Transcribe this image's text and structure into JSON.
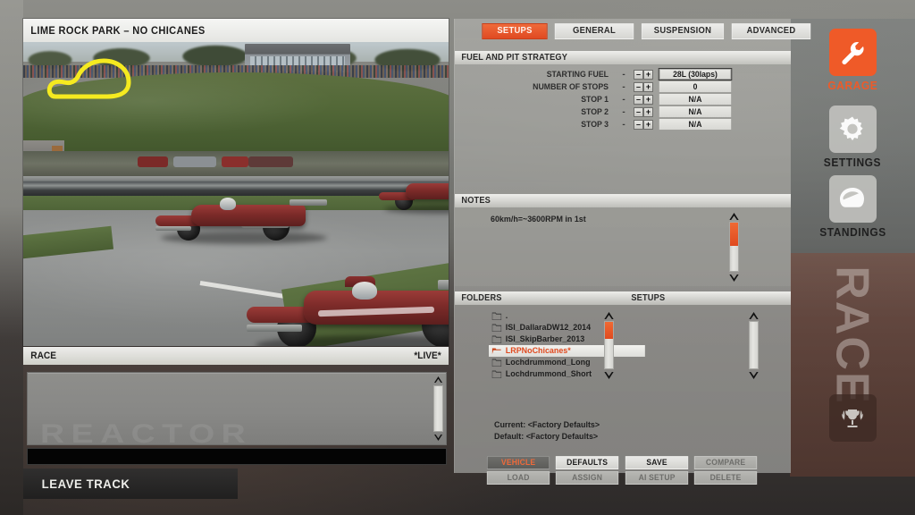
{
  "viewport": {
    "track_title": "LIME ROCK PARK – NO CHICANES",
    "minimap_name": "track-minimap"
  },
  "race_bar": {
    "label": "RACE",
    "status": "*LIVE*"
  },
  "chat": {
    "watermark": "REACTOR",
    "input_value": ""
  },
  "leave_track": {
    "label": "LEAVE TRACK"
  },
  "setup_panel": {
    "tabs": [
      {
        "label": "SETUPS",
        "active": true
      },
      {
        "label": "GENERAL",
        "active": false
      },
      {
        "label": "SUSPENSION",
        "active": false
      },
      {
        "label": "ADVANCED",
        "active": false
      }
    ],
    "fuel_section": {
      "heading": "FUEL AND PIT STRATEGY",
      "rows": [
        {
          "name": "STARTING FUEL",
          "dash": "-",
          "minus": "–",
          "plus": "+",
          "value": "28L (30laps)",
          "focused": true
        },
        {
          "name": "NUMBER OF STOPS",
          "dash": "-",
          "minus": "–",
          "plus": "+",
          "value": "0",
          "focused": false
        },
        {
          "name": "STOP 1",
          "dash": "-",
          "minus": "–",
          "plus": "+",
          "value": "N/A",
          "focused": false
        },
        {
          "name": "STOP 2",
          "dash": "-",
          "minus": "–",
          "plus": "+",
          "value": "N/A",
          "focused": false
        },
        {
          "name": "STOP 3",
          "dash": "-",
          "minus": "–",
          "plus": "+",
          "value": "N/A",
          "focused": false
        }
      ]
    },
    "notes_section": {
      "heading": "NOTES",
      "text": "60km/h=~3600RPM in 1st"
    },
    "folders_section": {
      "heading": "FOLDERS",
      "heading_right": "SETUPS",
      "folders": [
        {
          "label": ".",
          "selected": false
        },
        {
          "label": "ISI_DallaraDW12_2014",
          "selected": false
        },
        {
          "label": "ISI_SkipBarber_2013",
          "selected": false
        },
        {
          "label": "LRPNoChicanes*",
          "selected": true
        },
        {
          "label": "Lochdrummond_Long",
          "selected": false
        },
        {
          "label": "Lochdrummond_Short",
          "selected": false
        }
      ],
      "setups": []
    },
    "meta": {
      "current": "Current: <Factory Defaults>",
      "default": "Default: <Factory Defaults>"
    },
    "buttons": [
      {
        "label": "VEHICLE",
        "state": "active"
      },
      {
        "label": "DEFAULTS",
        "state": "normal"
      },
      {
        "label": "SAVE",
        "state": "normal"
      },
      {
        "label": "COMPARE",
        "state": "dim"
      },
      {
        "label": "LOAD",
        "state": "dim"
      },
      {
        "label": "ASSIGN",
        "state": "dim"
      },
      {
        "label": "AI SETUP",
        "state": "dim"
      },
      {
        "label": "DELETE",
        "state": "dim"
      }
    ]
  },
  "nav_rail": {
    "items": [
      {
        "label": "GARAGE",
        "icon": "wrench-icon",
        "active": true
      },
      {
        "label": "SETTINGS",
        "icon": "gear-icon",
        "active": false
      },
      {
        "label": "STANDINGS",
        "icon": "helmet-icon",
        "active": false
      }
    ],
    "race_section": {
      "label": "RACE",
      "icon": "trophy-icon"
    }
  },
  "colors": {
    "accent": "#ef5a28",
    "accent_dark": "#e04a1f",
    "panel": "#a8a8a4",
    "panel_light": "#e9e9e5",
    "text_dark": "#1d1d1d"
  }
}
